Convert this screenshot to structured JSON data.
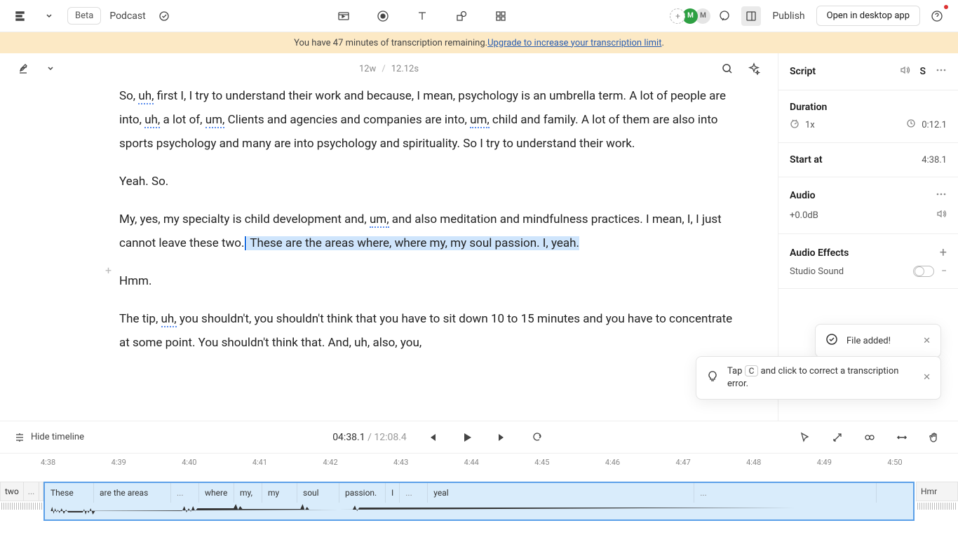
{
  "topbar": {
    "beta": "Beta",
    "podcast": "Podcast",
    "publish": "Publish",
    "open_desktop": "Open in desktop app",
    "avatar1": "M",
    "avatar2": "M"
  },
  "banner": {
    "pre": "You have 47 minutes of transcription remaining. ",
    "link": "Upgrade to increase your transcription limit",
    "post": "."
  },
  "ed_meta": {
    "left": "12w",
    "sep": "/",
    "right": "12.12s"
  },
  "transcript": {
    "p1a": "So, ",
    "p1_uh": "uh,",
    "p1b": " first I, I try to understand their work and because, I mean, psychology is an umbrella term. A lot of people are into, ",
    "p1_uh2": "uh,",
    "p1c": " a lot of, ",
    "p1_um": "um,",
    "p1d": " Clients and agencies and companies are into, ",
    "p1_um2": "um,",
    "p1e": " child and family. A lot of them are also into sports psychology and many are into psychology and spirituality. So I try to understand their work.",
    "p2": "Yeah. So.",
    "p3a": "My, yes, my specialty is child development and, ",
    "p3_um": "um,",
    "p3b": " and also meditation and mindfulness practices. I mean, I, I just cannot leave these two.",
    "p3_hl": " These are the areas where, where my, my soul passion. I, yeah.",
    "p4": "Hmm.",
    "p5a": "The tip, ",
    "p5_uh": "uh,",
    "p5b": " you shouldn't, you shouldn't think that you have to sit down 10 to 15 minutes and you have to concentrate at some point. You shouldn't think that. And, uh, also, you,"
  },
  "side": {
    "script": "Script",
    "s_badge": "S",
    "duration": "Duration",
    "speed": "1x",
    "dur_val": "0:12.1",
    "start_at": "Start at",
    "start_val": "4:38.1",
    "audio": "Audio",
    "gain": "+0.0dB",
    "effects": "Audio Effects",
    "studio": "Studio Sound"
  },
  "toast1": {
    "text": "File added!"
  },
  "toast2": {
    "pre": "Tap ",
    "key": "C",
    "post": " and click to correct a transcription error."
  },
  "play": {
    "hide": "Hide timeline",
    "cur": "04:38.1",
    "sep": " / ",
    "dur": "12:08.4"
  },
  "ruler": [
    "4:38",
    "4:39",
    "4:40",
    "4:41",
    "4:42",
    "4:43",
    "4:44",
    "4:45",
    "4:46",
    "4:47",
    "4:48",
    "4:49",
    "4:50"
  ],
  "clip": {
    "pre1": "two",
    "pre2": "...",
    "words": [
      "These",
      "are the areas",
      "...",
      "where",
      "my,",
      "my",
      "soul",
      "passion.",
      "I",
      "...",
      "yeal",
      "",
      "",
      "",
      "",
      "",
      "",
      "",
      "...",
      ""
    ],
    "post": "Hmr"
  }
}
